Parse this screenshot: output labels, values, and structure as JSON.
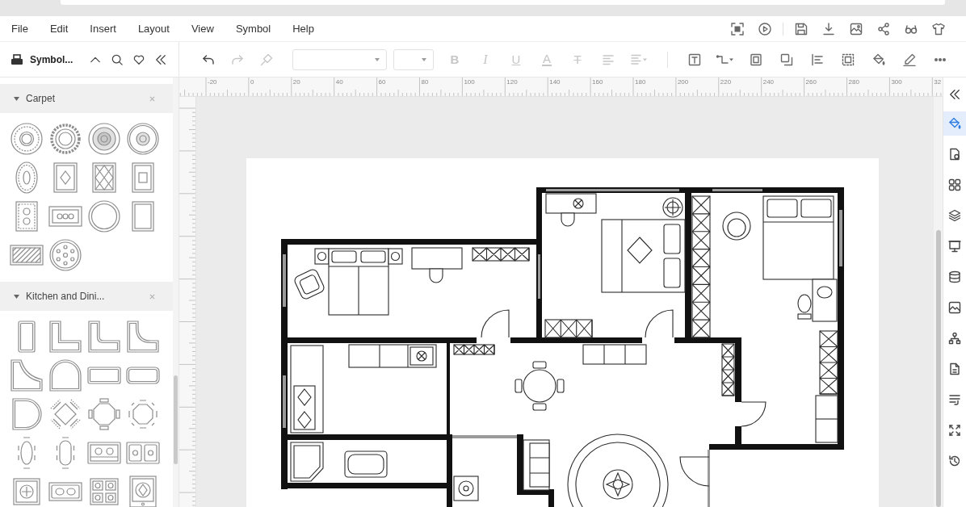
{
  "menu": {
    "items": [
      "File",
      "Edit",
      "Insert",
      "Layout",
      "View",
      "Symbol",
      "Help"
    ],
    "action_groups": [
      [
        {
          "kind": "focus"
        },
        {
          "kind": "present"
        }
      ],
      [
        {
          "kind": "save"
        },
        {
          "kind": "download"
        },
        {
          "kind": "export"
        },
        {
          "kind": "share"
        },
        {
          "kind": "preview"
        },
        {
          "kind": "theme"
        }
      ]
    ]
  },
  "library": {
    "title": "Symbol...",
    "actions": [
      {
        "kind": "collapse-up"
      },
      {
        "kind": "search"
      },
      {
        "kind": "favorite"
      },
      {
        "kind": "hide"
      }
    ],
    "sections": [
      {
        "title": "Carpet",
        "expanded": true,
        "symbols": [
          {
            "kind": "round-rug-ornate"
          },
          {
            "kind": "round-rug-scalloped"
          },
          {
            "kind": "round-rug-shaded"
          },
          {
            "kind": "round-rug-ring"
          },
          {
            "kind": "oval-rug"
          },
          {
            "kind": "rect-rug-medallion"
          },
          {
            "kind": "rect-rug-diamond"
          },
          {
            "kind": "rect-rug-tall"
          },
          {
            "kind": "rect-rug-pattern"
          },
          {
            "kind": "rect-rug-wide"
          },
          {
            "kind": "round-rug-plain"
          },
          {
            "kind": "rect-rug-plain"
          },
          {
            "kind": "rect-rug-striped"
          },
          {
            "kind": "round-rug-dotted"
          }
        ]
      },
      {
        "title": "Kitchen and Dini...",
        "expanded": true,
        "symbols": [
          {
            "kind": "counter-straight"
          },
          {
            "kind": "counter-l"
          },
          {
            "kind": "counter-l-round"
          },
          {
            "kind": "counter-l-curved"
          },
          {
            "kind": "counter-corner-curved"
          },
          {
            "kind": "counter-arched"
          },
          {
            "kind": "counter-rect"
          },
          {
            "kind": "counter-rect-round"
          },
          {
            "kind": "table-d-shape"
          },
          {
            "kind": "table-square-chairs"
          },
          {
            "kind": "table-round-chairs"
          },
          {
            "kind": "table-octagon-chairs"
          },
          {
            "kind": "table-oval-6"
          },
          {
            "kind": "table-oval-6b"
          },
          {
            "kind": "sink-double"
          },
          {
            "kind": "sink-double-b"
          },
          {
            "kind": "cooktop-round"
          },
          {
            "kind": "sink-wide"
          },
          {
            "kind": "cooktop-4"
          },
          {
            "kind": "cooktop-ornate"
          }
        ]
      }
    ]
  },
  "toolbar": {
    "edit": [
      {
        "kind": "undo",
        "disabled": false
      },
      {
        "kind": "redo",
        "disabled": true
      },
      {
        "kind": "format-painter",
        "disabled": true
      }
    ],
    "text": [
      {
        "kind": "bold",
        "label": "B",
        "disabled": true
      },
      {
        "kind": "italic",
        "label": "I",
        "disabled": true
      },
      {
        "kind": "underline",
        "label": "U",
        "disabled": true
      },
      {
        "kind": "font-color",
        "label": "A",
        "disabled": true
      },
      {
        "kind": "strikethrough",
        "label": "T",
        "disabled": true
      },
      {
        "kind": "align",
        "disabled": true
      },
      {
        "kind": "line-spacing",
        "disabled": true
      }
    ],
    "arrange": [
      {
        "kind": "text-box"
      },
      {
        "kind": "connector"
      },
      {
        "kind": "frame"
      },
      {
        "kind": "duplicate"
      },
      {
        "kind": "align-left"
      },
      {
        "kind": "group"
      },
      {
        "kind": "fill"
      },
      {
        "kind": "line-color"
      },
      {
        "kind": "more"
      }
    ]
  },
  "ruler": {
    "labels": [
      "-20",
      "0",
      "20",
      "40",
      "60",
      "80",
      "100",
      "120",
      "140",
      "160",
      "180",
      "200",
      "220",
      "240",
      "260",
      "280",
      "300",
      "32"
    ]
  },
  "side_panel": {
    "tabs": [
      {
        "kind": "fill",
        "selected": true
      },
      {
        "kind": "page-settings",
        "selected": false
      },
      {
        "kind": "symbols",
        "selected": false
      },
      {
        "kind": "layers",
        "selected": false
      },
      {
        "kind": "presentation",
        "selected": false
      },
      {
        "kind": "data",
        "selected": false
      },
      {
        "kind": "image",
        "selected": false
      },
      {
        "kind": "hierarchy",
        "selected": false
      },
      {
        "kind": "file",
        "selected": false
      },
      {
        "kind": "outline",
        "selected": false
      },
      {
        "kind": "fit",
        "selected": false
      },
      {
        "kind": "history",
        "selected": false
      }
    ]
  }
}
